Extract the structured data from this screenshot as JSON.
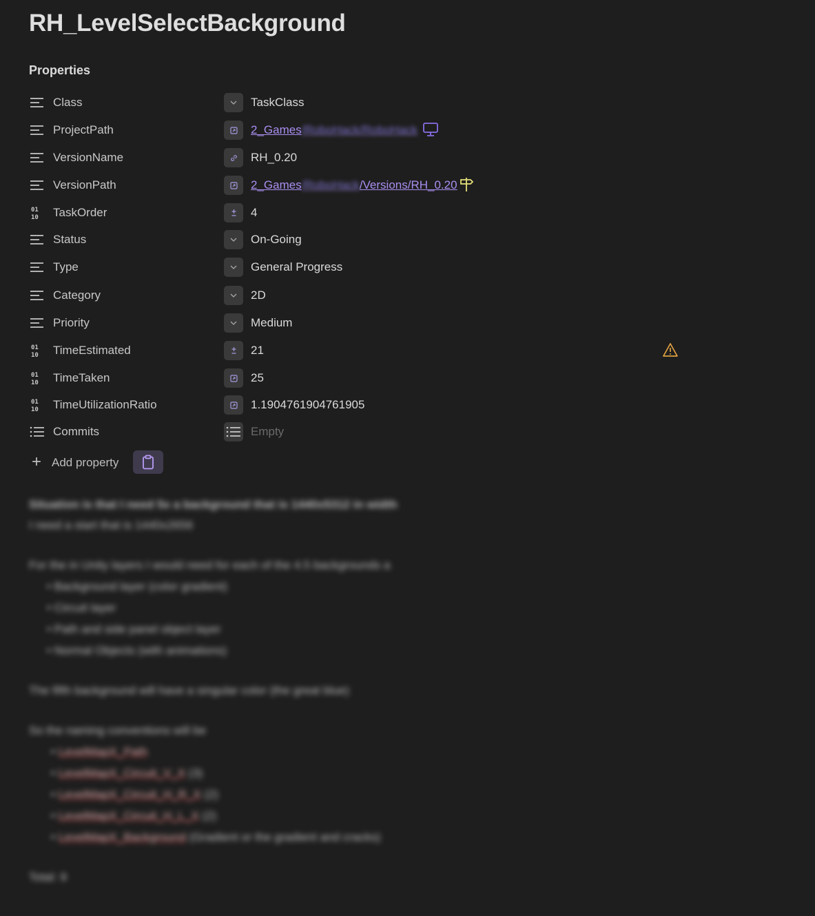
{
  "page": {
    "title": "RH_LevelSelectBackground"
  },
  "properties_heading": "Properties",
  "properties": [
    {
      "key": "Class",
      "type_icon": "list-icon",
      "type_btn": "chevron-down-icon",
      "value": "TaskClass"
    },
    {
      "key": "ProjectPath",
      "type_icon": "list-icon",
      "type_btn": "file-link-icon",
      "value_visible": "2_Games",
      "value_blurred": "/RoboHack/RoboHack",
      "trailing_icon": "monitor-icon"
    },
    {
      "key": "VersionName",
      "type_icon": "list-icon",
      "type_btn": "link-icon",
      "value": "RH_0.20"
    },
    {
      "key": "VersionPath",
      "type_icon": "list-icon",
      "type_btn": "file-link-icon",
      "value_visible": "2_Games",
      "value_blurred": "/RoboHack",
      "value_tail": "/Versions/RH_0.20",
      "trailing_icon": "signpost-icon"
    },
    {
      "key": "TaskOrder",
      "type_icon": "binary-icon",
      "type_btn": "plus-minus-icon",
      "value": "4"
    },
    {
      "key": "Status",
      "type_icon": "list-icon",
      "type_btn": "chevron-down-icon",
      "value": "On-Going"
    },
    {
      "key": "Type",
      "type_icon": "list-icon",
      "type_btn": "chevron-down-icon",
      "value": "General Progress"
    },
    {
      "key": "Category",
      "type_icon": "list-icon",
      "type_btn": "chevron-down-icon",
      "value": "2D"
    },
    {
      "key": "Priority",
      "type_icon": "list-icon",
      "type_btn": "chevron-down-icon",
      "value": "Medium"
    },
    {
      "key": "TimeEstimated",
      "type_icon": "binary-icon",
      "type_btn": "plus-minus-icon",
      "value": "21",
      "trailing_icon": "warning-icon"
    },
    {
      "key": "TimeTaken",
      "type_icon": "binary-icon",
      "type_btn": "file-link-icon",
      "value": "25"
    },
    {
      "key": "TimeUtilizationRatio",
      "type_icon": "binary-icon",
      "type_btn": "file-link-icon",
      "value": "1.1904761904761905"
    },
    {
      "key": "Commits",
      "type_icon": "bullet-list-icon",
      "type_btn": "bullet-list-icon",
      "value": "Empty"
    }
  ],
  "add_property": {
    "label": "Add property",
    "clipboard_icon": "clipboard-icon"
  },
  "colors": {
    "background": "#1e1e1e",
    "link": "#a98ef0",
    "accent_monitor": "#8a6fe8",
    "signpost": "#e5e07a",
    "warning": "#e0a040"
  },
  "body": {
    "line1": "Situation is that I need 5x a background that is 1440x5312 in width",
    "line2": "I need a start that is 1440x2656",
    "line3": "For the in Unity layers I would need for each of the 4.5 backgrounds a",
    "list1": [
      "Background layer (color gradient)",
      "Circuit layer",
      "Path and side panel object layer",
      "Normal Objects (with animations)"
    ],
    "line4": "The fifth background will have a singular color (the great blue)",
    "line5": "So the naming conventions will be",
    "list2": [
      {
        "name": "LevelMapX_Path",
        "suffix": ""
      },
      {
        "name": "LevelMapX_Circuit_V_X",
        "suffix": " (3)"
      },
      {
        "name": "LevelMapX_Circuit_H_R_X",
        "suffix": " (2)"
      },
      {
        "name": "LevelMapX_Circuit_H_L_X",
        "suffix": " (2)"
      },
      {
        "name": "LevelMapX_Background",
        "suffix": " (Gradient or the gradient and cracks)"
      }
    ],
    "total": "Total: 9"
  }
}
